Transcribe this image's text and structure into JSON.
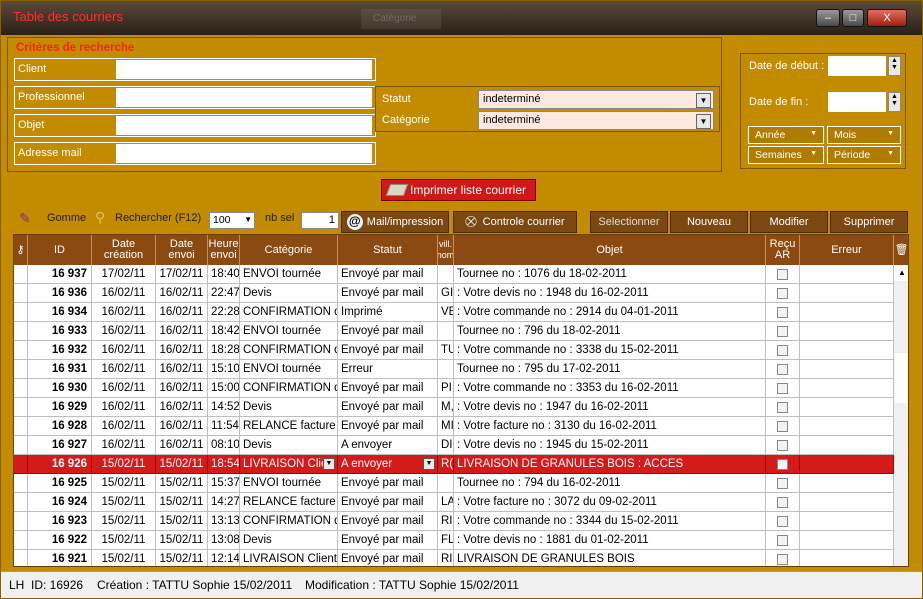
{
  "window": {
    "title": "Table des courriers",
    "ghost_tab": "Catégorie",
    "min": "–",
    "max": "□",
    "close": "X"
  },
  "criteria": {
    "title": "Critères de recherche",
    "fields": [
      "Client",
      "Professionnel",
      "Objet",
      "Adresse mail"
    ],
    "statut_label": "Statut",
    "statut_value": "indeterminé",
    "categorie_label": "Catégorie",
    "categorie_value": "indeterminé"
  },
  "dates": {
    "debut_label": "Date de début :",
    "fin_label": "Date de fin :",
    "annee": "Année",
    "mois": "Mois",
    "semaines": "Semaines",
    "periode": "Période"
  },
  "print_button": "Imprimer liste courrier",
  "toolbar": {
    "gomme": "Gomme",
    "rechercher": "Rechercher (F12)",
    "limit": "100",
    "nb_sel_label": "nb sel",
    "nb_sel_value": "1",
    "mail_impression": "Mail/impression",
    "controle": "Controle courrier",
    "selectionner": "Selectionner",
    "nouveau": "Nouveau",
    "modifier": "Modifier",
    "supprimer": "Supprimer"
  },
  "grid": {
    "headers": [
      "ID",
      "Date création",
      "Date envoi",
      "Heure envoi",
      "Catégorie",
      "Statut",
      "vill. nom",
      "Objet",
      "Reçu AR",
      "Erreur"
    ],
    "rows": [
      {
        "id": "16 937",
        "date_creation": "17/02/11",
        "date_envoi": "17/02/11",
        "heure": "18:40",
        "categorie": "ENVOI tournée",
        "statut": "Envoyé par mail",
        "ville": "",
        "objet": "Tournee no : 1076 du 18-02-2011"
      },
      {
        "id": "16 936",
        "date_creation": "16/02/11",
        "date_envoi": "16/02/11",
        "heure": "22:47",
        "categorie": "Devis",
        "statut": "Envoyé par mail",
        "ville": "GI",
        "objet": ": Votre  devis no : 1948 du 16-02-2011"
      },
      {
        "id": "16 934",
        "date_creation": "16/02/11",
        "date_envoi": "16/02/11",
        "heure": "22:28",
        "categorie": "CONFIRMATION de",
        "statut": "Imprimé",
        "ville": "VE",
        "objet": ": Votre  commande no : 2914 du 04-01-2011"
      },
      {
        "id": "16 933",
        "date_creation": "16/02/11",
        "date_envoi": "16/02/11",
        "heure": "18:42",
        "categorie": "ENVOI tournée",
        "statut": "Envoyé par mail",
        "ville": "",
        "objet": "Tournee no : 796 du 18-02-2011"
      },
      {
        "id": "16 932",
        "date_creation": "16/02/11",
        "date_envoi": "16/02/11",
        "heure": "18:28",
        "categorie": "CONFIRMATION de",
        "statut": "Envoyé par mail",
        "ville": "TU",
        "objet": ": Votre  commande no : 3338 du 15-02-2011"
      },
      {
        "id": "16 931",
        "date_creation": "16/02/11",
        "date_envoi": "16/02/11",
        "heure": "15:10",
        "categorie": "ENVOI tournée",
        "statut": "Erreur",
        "ville": "",
        "objet": "Tournee no : 795 du 17-02-2011"
      },
      {
        "id": "16 930",
        "date_creation": "16/02/11",
        "date_envoi": "16/02/11",
        "heure": "15:00",
        "categorie": "CONFIRMATION de",
        "statut": "Envoyé par mail",
        "ville": "PI",
        "objet": ": Votre  commande no : 3353 du 16-02-2011"
      },
      {
        "id": "16 929",
        "date_creation": "16/02/11",
        "date_envoi": "16/02/11",
        "heure": "14:52",
        "categorie": "Devis",
        "statut": "Envoyé par mail",
        "ville": "M,",
        "objet": ": Votre  devis no : 1947 du 16-02-2011"
      },
      {
        "id": "16 928",
        "date_creation": "16/02/11",
        "date_envoi": "16/02/11",
        "heure": "11:54",
        "categorie": "RELANCE facture",
        "statut": "Envoyé par mail",
        "ville": "MI",
        "objet": ": Votre  facture no : 3130 du 16-02-2011"
      },
      {
        "id": "16 927",
        "date_creation": "16/02/11",
        "date_envoi": "16/02/11",
        "heure": "08:10",
        "categorie": "Devis",
        "statut": "A envoyer",
        "ville": "DI",
        "objet": ": Votre  devis no : 1945 du 15-02-2011"
      },
      {
        "id": "16 926",
        "date_creation": "15/02/11",
        "date_envoi": "15/02/11",
        "heure": "18:54",
        "categorie": "LIVRAISON Clie",
        "statut": "A envoyer",
        "ville": "R(",
        "objet": "LIVRAISON DE GRANULES BOIS : ACCES",
        "selected": true
      },
      {
        "id": "16 925",
        "date_creation": "15/02/11",
        "date_envoi": "15/02/11",
        "heure": "15:37",
        "categorie": "ENVOI tournée",
        "statut": "Envoyé par mail",
        "ville": "",
        "objet": "Tournee no : 794 du 16-02-2011"
      },
      {
        "id": "16 924",
        "date_creation": "15/02/11",
        "date_envoi": "15/02/11",
        "heure": "14:27",
        "categorie": "RELANCE facture",
        "statut": "Envoyé par mail",
        "ville": "LA",
        "objet": ": Votre  facture no : 3072 du 09-02-2011"
      },
      {
        "id": "16 923",
        "date_creation": "15/02/11",
        "date_envoi": "15/02/11",
        "heure": "13:13",
        "categorie": "CONFIRMATION de",
        "statut": "Envoyé par mail",
        "ville": "RI",
        "objet": ": Votre  commande no : 3344 du 15-02-2011"
      },
      {
        "id": "16 922",
        "date_creation": "15/02/11",
        "date_envoi": "15/02/11",
        "heure": "13:08",
        "categorie": "Devis",
        "statut": "Envoyé par mail",
        "ville": "FL",
        "objet": ": Votre  devis no : 1881 du 01-02-2011"
      },
      {
        "id": "16 921",
        "date_creation": "15/02/11",
        "date_envoi": "15/02/11",
        "heure": "12:14",
        "categorie": "LIVRAISON Client",
        "statut": "Envoyé par mail",
        "ville": "RI",
        "objet": "LIVRAISON DE GRANULES BOIS"
      }
    ]
  },
  "status": {
    "lh": "LH",
    "id": "ID: 16926",
    "creation": "Création : TATTU Sophie 15/02/2011",
    "modification": "Modification : TATTU Sophie  15/02/2011"
  },
  "colors": {
    "background": "#c28b00",
    "header": "#8a4a12",
    "selected_row": "#d51a1a",
    "title_text": "#ff3030"
  }
}
